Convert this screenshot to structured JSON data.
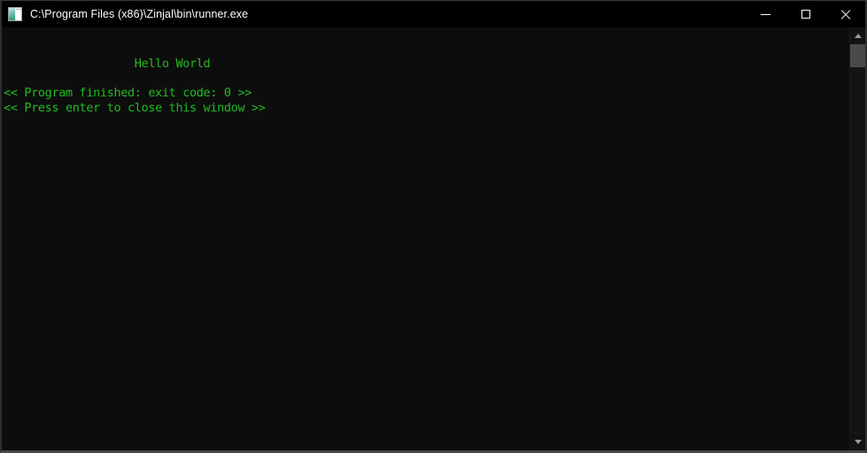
{
  "window": {
    "title": "C:\\Program Files (x86)\\Zinjal\\bin\\runner.exe",
    "icon": "program-window-icon",
    "background_color": "#0d0d0d",
    "titlebar_color": "#000000",
    "border_color": "#2e2e2e"
  },
  "caption_buttons": {
    "minimize": {
      "label": "Minimize",
      "icon": "minimize-icon"
    },
    "maximize": {
      "label": "Maximize",
      "icon": "maximize-icon"
    },
    "close": {
      "label": "Close",
      "icon": "close-icon"
    }
  },
  "console": {
    "text_color": "#22bb22",
    "background_color": "#0d0d0d",
    "lines": [
      "",
      "",
      "                   Hello World",
      "",
      "<< Program finished: exit code: 0 >>",
      "<< Press enter to close this window >>"
    ],
    "content": "\n\n                   Hello World\n\n<< Program finished: exit code: 0 >>\n<< Press enter to close this window >>",
    "output_message": "Hello World",
    "status_line": "<< Program finished: exit code: 0 >>",
    "prompt_line": "<< Press enter to close this window >>",
    "exit_code": "0"
  },
  "scrollbar": {
    "up_arrow_icon": "chevron-up-icon",
    "down_arrow_icon": "chevron-down-icon",
    "thumb_position_percent": 0,
    "thumb_size_percent": 6
  }
}
